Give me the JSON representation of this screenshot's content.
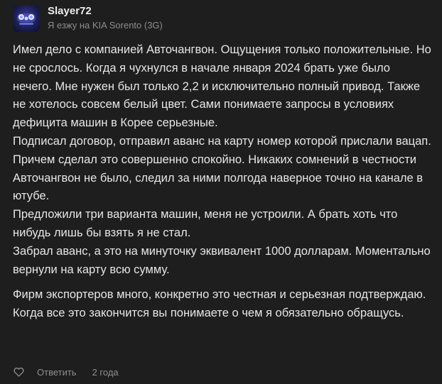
{
  "comment": {
    "author": "Slayer72",
    "car": "Я езжу на KIA Sorento (3G)",
    "paragraphs": [
      "Имел дело с компанией Авточангвон. Ощущения только положительные. Но не срослось. Когда я чухнулся в начале января 2024 брать уже было нечего. Мне нужен был только 2,2 и исключительно полный привод. Также не хотелось совсем белый цвет. Сами понимаете запросы в условиях дефицита машин в Корее серьезные.",
      "Подписал договор, отправил аванс на карту номер которой прислали вацап. Причем сделал это совершенно спокойно. Никаких сомнений в честности Авточангвон не было, следил за ними полгода наверное точно на канале в ютубе.",
      "Предложили три варианта машин, меня не устроили. А брать хоть что нибудь лишь бы взять я не стал.",
      "Забрал аванс, а это на минуточку эквивалент 1000 долларам. Моментально вернули на карту всю сумму.",
      "Фирм экспортеров много, конкретно это честная и серьезная подтверждаю. Когда все это закончится вы понимаете о чем я обязательно обращусь."
    ],
    "footer": {
      "like_icon": "heart-outline-icon",
      "reply_label": "Ответить",
      "time": "2 года"
    }
  },
  "colors": {
    "background": "#1e1e1e",
    "text": "#e6e6e6",
    "muted": "#8e8e8e",
    "avatar_bg": "#1d1f55"
  }
}
